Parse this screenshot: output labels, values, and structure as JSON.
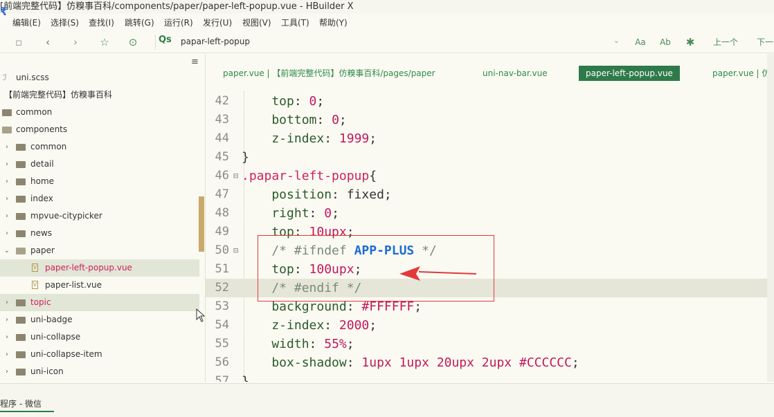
{
  "window": {
    "title": "[前端完整代码】仿糗事百科/components/paper/paper-left-popup.vue - HBuilder X"
  },
  "menu": [
    "编辑(E)",
    "选择(S)",
    "查找(I)",
    "跳转(G)",
    "运行(R)",
    "发行(U)",
    "视图(V)",
    "工具(T)",
    "帮助(Y)"
  ],
  "toolbar": {
    "search_value": "papar-left-popup",
    "font_icon_label": "Aa",
    "prev_label": "上一个",
    "next_label": "下一"
  },
  "sidebar": {
    "items": [
      {
        "label": "uni.scss",
        "kind": "style"
      },
      {
        "label": "【前端完整代码】仿糗事百科",
        "kind": "project"
      },
      {
        "label": "common",
        "kind": "folder"
      },
      {
        "label": "components",
        "kind": "folder-open"
      },
      {
        "label": "common",
        "kind": "folder"
      },
      {
        "label": "detail",
        "kind": "folder"
      },
      {
        "label": "home",
        "kind": "folder"
      },
      {
        "label": "index",
        "kind": "folder"
      },
      {
        "label": "mpvue-citypicker",
        "kind": "folder"
      },
      {
        "label": "news",
        "kind": "folder"
      },
      {
        "label": "paper",
        "kind": "folder-open"
      },
      {
        "label": "paper-left-popup.vue",
        "kind": "vue"
      },
      {
        "label": "paper-list.vue",
        "kind": "vue"
      },
      {
        "label": "topic",
        "kind": "folder"
      },
      {
        "label": "uni-badge",
        "kind": "folder"
      },
      {
        "label": "uni-collapse",
        "kind": "folder"
      },
      {
        "label": "uni-collapse-item",
        "kind": "folder"
      },
      {
        "label": "uni-icon",
        "kind": "folder"
      }
    ]
  },
  "tabs": [
    {
      "label": "paper.vue | 【前端完整代码】仿糗事百科/pages/paper",
      "active": false
    },
    {
      "label": "uni-nav-bar.vue",
      "active": false
    },
    {
      "label": "paper-left-popup.vue",
      "active": true
    },
    {
      "label": "paper.vue | 仿",
      "active": false
    }
  ],
  "editor": {
    "lines": [
      {
        "n": "42",
        "seg": [
          [
            "k",
            "    top"
          ],
          [
            "p",
            ": "
          ],
          [
            "n",
            "0"
          ],
          [
            "p",
            ";"
          ]
        ]
      },
      {
        "n": "43",
        "seg": [
          [
            "k",
            "    bottom"
          ],
          [
            "p",
            ": "
          ],
          [
            "n",
            "0"
          ],
          [
            "p",
            ";"
          ]
        ]
      },
      {
        "n": "44",
        "seg": [
          [
            "k",
            "    z-index"
          ],
          [
            "p",
            ": "
          ],
          [
            "n",
            "1999"
          ],
          [
            "p",
            ";"
          ]
        ]
      },
      {
        "n": "45",
        "seg": [
          [
            "p",
            "}"
          ]
        ]
      },
      {
        "n": "46",
        "seg": [
          [
            "sel",
            ".papar-left-popup"
          ],
          [
            "p",
            "{"
          ]
        ]
      },
      {
        "n": "47",
        "seg": [
          [
            "k",
            "    position"
          ],
          [
            "p",
            ": fixed;"
          ]
        ]
      },
      {
        "n": "48",
        "seg": [
          [
            "k",
            "    right"
          ],
          [
            "p",
            ": "
          ],
          [
            "n",
            "0"
          ],
          [
            "p",
            ";"
          ]
        ]
      },
      {
        "n": "49",
        "seg": [
          [
            "k",
            "    top"
          ],
          [
            "p",
            ": "
          ],
          [
            "n",
            "10upx"
          ],
          [
            "p",
            ";"
          ]
        ]
      },
      {
        "n": "50",
        "seg": [
          [
            "c",
            "    /* #ifndef "
          ],
          [
            "kw",
            "APP-PLUS"
          ],
          [
            "c",
            " */"
          ]
        ]
      },
      {
        "n": "51",
        "seg": [
          [
            "k",
            "    top"
          ],
          [
            "p",
            ": "
          ],
          [
            "n",
            "100upx"
          ],
          [
            "p",
            ";"
          ]
        ]
      },
      {
        "n": "52",
        "seg": [
          [
            "c",
            "    /* #endif */"
          ]
        ]
      },
      {
        "n": "53",
        "seg": [
          [
            "k",
            "    background"
          ],
          [
            "p",
            ": "
          ],
          [
            "n",
            "#FFFFFF"
          ],
          [
            "p",
            ";"
          ]
        ]
      },
      {
        "n": "54",
        "seg": [
          [
            "k",
            "    z-index"
          ],
          [
            "p",
            ": "
          ],
          [
            "n",
            "2000"
          ],
          [
            "p",
            ";"
          ]
        ]
      },
      {
        "n": "55",
        "seg": [
          [
            "k",
            "    width"
          ],
          [
            "p",
            ": "
          ],
          [
            "n",
            "55%"
          ],
          [
            "p",
            ";"
          ]
        ]
      },
      {
        "n": "56",
        "seg": [
          [
            "k",
            "    box-shadow"
          ],
          [
            "p",
            ": "
          ],
          [
            "n",
            "1upx 1upx 20upx 2upx #CCCCCC"
          ],
          [
            "p",
            ";"
          ]
        ]
      },
      {
        "n": "57",
        "seg": [
          [
            "p",
            "}"
          ]
        ]
      }
    ],
    "folded_lines": [
      "46",
      "50"
    ]
  },
  "status": {
    "text": "程序 - 微信"
  },
  "colors": {
    "accent": "#2f7a4a",
    "annotation": "#e23a3a"
  }
}
